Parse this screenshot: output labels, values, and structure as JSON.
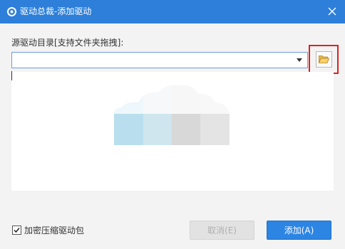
{
  "window": {
    "title": "驱动总裁-添加驱动",
    "accent_color": "#2d7fd9"
  },
  "icons": {
    "app": "gear-refresh-icon",
    "close": "close-icon",
    "dropdown": "chevron-down-icon",
    "folder": "folder-open-icon",
    "empty": "cloud-icon",
    "check": "checkmark-icon"
  },
  "form": {
    "source_label": "源驱动目录[支持文件夹拖拽]:",
    "source_value": ""
  },
  "options": {
    "compress_label": "加密压缩驱动包",
    "compress_checked": true
  },
  "buttons": {
    "cancel_label": "取消(E)",
    "add_label": "添加(A)"
  }
}
